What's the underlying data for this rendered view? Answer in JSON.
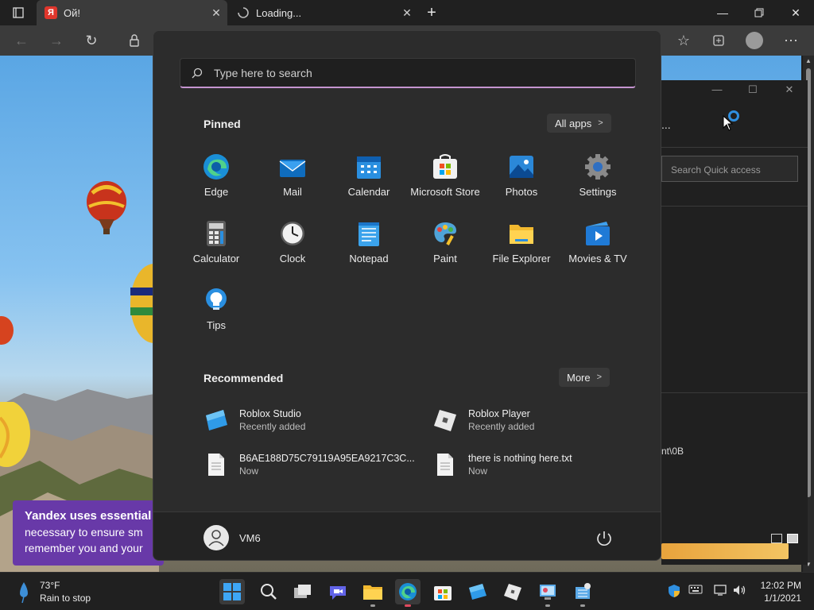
{
  "browser": {
    "tabs": [
      {
        "title": "Ой!",
        "favicon_text": "Я",
        "active": true
      },
      {
        "title": "Loading...",
        "active": false
      }
    ],
    "new_tab_symbol": "+"
  },
  "webpage": {
    "cookie_banner": {
      "heading": "Yandex uses essential",
      "line2": "necessary to ensure sm",
      "line3": "remember you and your"
    }
  },
  "explorer": {
    "search_placeholder": "Search Quick access",
    "path_fragment": "nt\\0B",
    "more_symbol": "..."
  },
  "start_menu": {
    "search_placeholder": "Type here to search",
    "pinned_title": "Pinned",
    "all_apps_label": "All apps",
    "pinned_apps": [
      {
        "label": "Edge",
        "icon": "edge-icon"
      },
      {
        "label": "Mail",
        "icon": "mail-icon"
      },
      {
        "label": "Calendar",
        "icon": "calendar-icon"
      },
      {
        "label": "Microsoft Store",
        "icon": "store-icon"
      },
      {
        "label": "Photos",
        "icon": "photos-icon"
      },
      {
        "label": "Settings",
        "icon": "gear-icon"
      },
      {
        "label": "Calculator",
        "icon": "calculator-icon"
      },
      {
        "label": "Clock",
        "icon": "clock-icon"
      },
      {
        "label": "Notepad",
        "icon": "notepad-icon"
      },
      {
        "label": "Paint",
        "icon": "paint-icon"
      },
      {
        "label": "File Explorer",
        "icon": "folder-icon"
      },
      {
        "label": "Movies & TV",
        "icon": "movies-icon"
      },
      {
        "label": "Tips",
        "icon": "lightbulb-icon"
      }
    ],
    "recommended_title": "Recommended",
    "more_label": "More",
    "recommended": [
      {
        "name": "Roblox Studio",
        "sub": "Recently added",
        "icon": "roblox-studio-icon"
      },
      {
        "name": "Roblox Player",
        "sub": "Recently added",
        "icon": "roblox-player-icon"
      },
      {
        "name": "B6AE188D75C79119A95EA9217C3C...",
        "sub": "Now",
        "icon": "file-icon"
      },
      {
        "name": "there is nothing here.txt",
        "sub": "Now",
        "icon": "file-icon"
      }
    ],
    "user": {
      "name": "VM6"
    }
  },
  "taskbar": {
    "weather": {
      "temp": "73°F",
      "desc": "Rain to stop"
    },
    "clock": {
      "time": "12:02 PM",
      "date": "1/1/2021"
    }
  },
  "colors": {
    "accent": "#0078d4",
    "search_underline": "#c594d0",
    "cookie_banner": "#6839a8",
    "active_indicator": "#e04a5f"
  }
}
